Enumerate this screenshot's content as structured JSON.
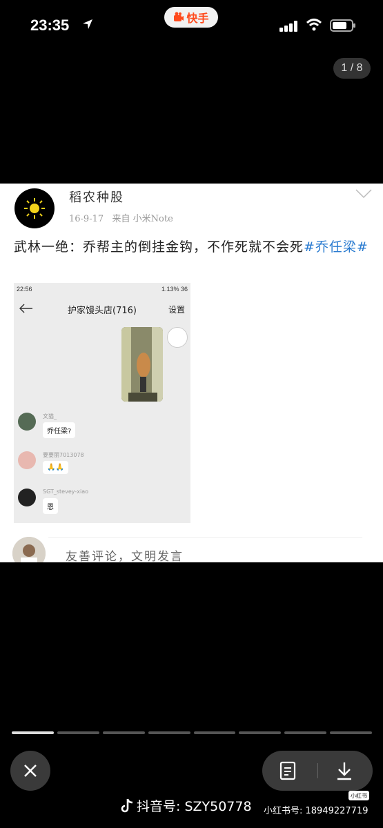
{
  "status_bar": {
    "time": "23:35",
    "app_name": "快手",
    "icons": [
      "location-arrow-icon",
      "signal-icon",
      "wifi-icon",
      "battery-icon"
    ]
  },
  "viewer": {
    "page_counter": "1 / 8",
    "progress": {
      "total_segments": 8,
      "current_index": 0
    }
  },
  "post": {
    "username": "稻农种股",
    "date": "16-9-17",
    "source": "来自 小米Note",
    "text_main": "武林一绝：乔帮主的倒挂金钩，不作死就不会死",
    "text_tag": "#乔任梁#",
    "embedded_screenshot": {
      "status_time": "22:56",
      "status_right": "1.13%  36",
      "group_title": "护家馒头店(716)",
      "settings_label": "设置",
      "messages": [
        {
          "nick": "文猫_",
          "text": "乔任梁?"
        },
        {
          "nick": "要要丽7013078",
          "text": "🙏🙏"
        },
        {
          "nick": "SGT_stevey-xiao",
          "text": "恩"
        }
      ]
    },
    "comment_placeholder": "友善评论，文明发言"
  },
  "controls": {
    "close_icon": "close-icon",
    "note_icon": "note-icon",
    "download_icon": "download-icon"
  },
  "watermarks": {
    "douyin_label": "抖音号: SZY50778",
    "xhs_badge": "小红书",
    "xhs_label": "小红书号: 18949227719"
  },
  "colors": {
    "hashtag": "#2a7bd0",
    "app_brand": "#ff4a1c",
    "background": "#000000"
  }
}
